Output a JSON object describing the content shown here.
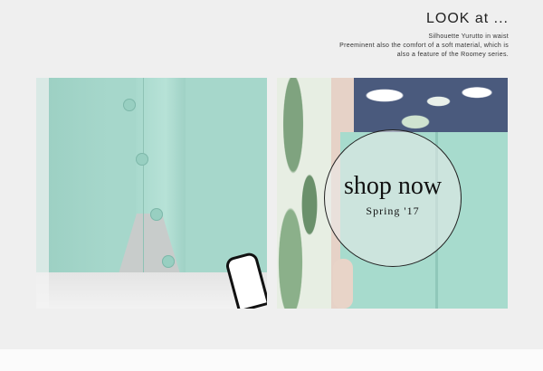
{
  "header": {
    "title": "LOOK at ...",
    "lines": [
      "Silhouette Yurutto in waist",
      "Preeminent also the comfort of a soft material, which is",
      "also a feature of the Roomey series."
    ]
  },
  "shop": {
    "title": "shop now",
    "subtitle": "Spring '17"
  },
  "colors": {
    "background": "#efefef",
    "mint": "#a6d7cb",
    "text": "#222222"
  }
}
